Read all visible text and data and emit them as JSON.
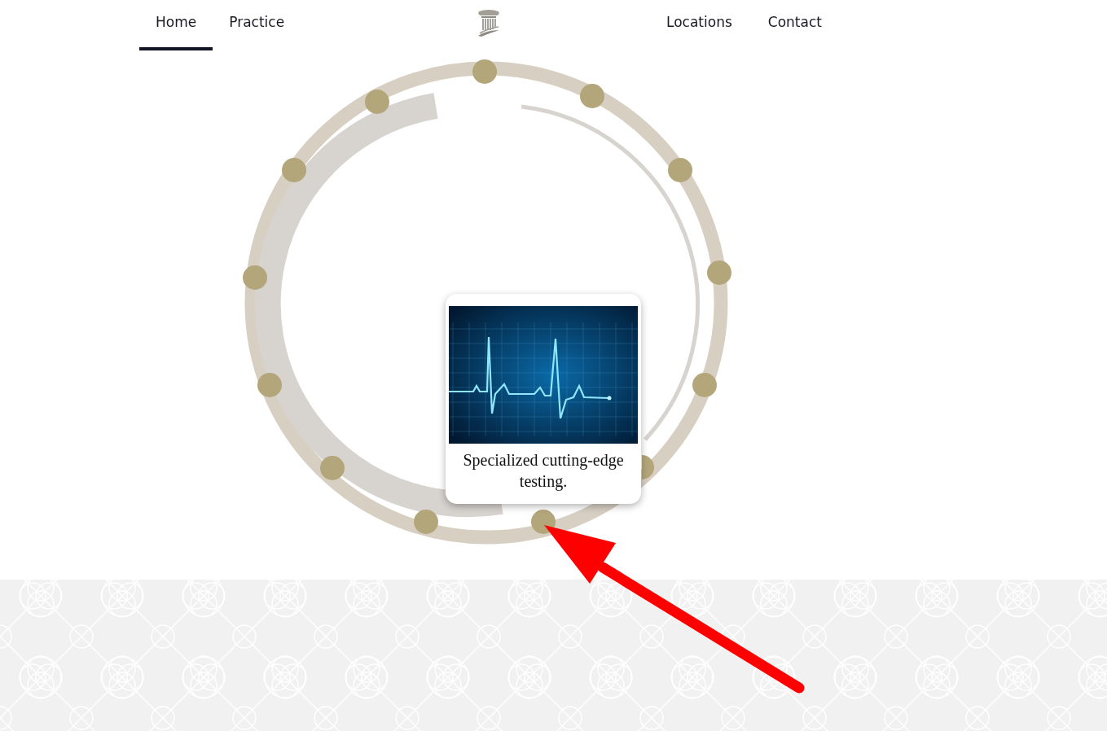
{
  "nav": {
    "left": [
      {
        "label": "Home",
        "selected": true
      },
      {
        "label": "Practice",
        "selected": false
      }
    ],
    "right": [
      {
        "label": "Locations",
        "selected": false
      },
      {
        "label": "Contact",
        "selected": false
      }
    ]
  },
  "card": {
    "caption": "Specialized cutting-edge testing."
  }
}
